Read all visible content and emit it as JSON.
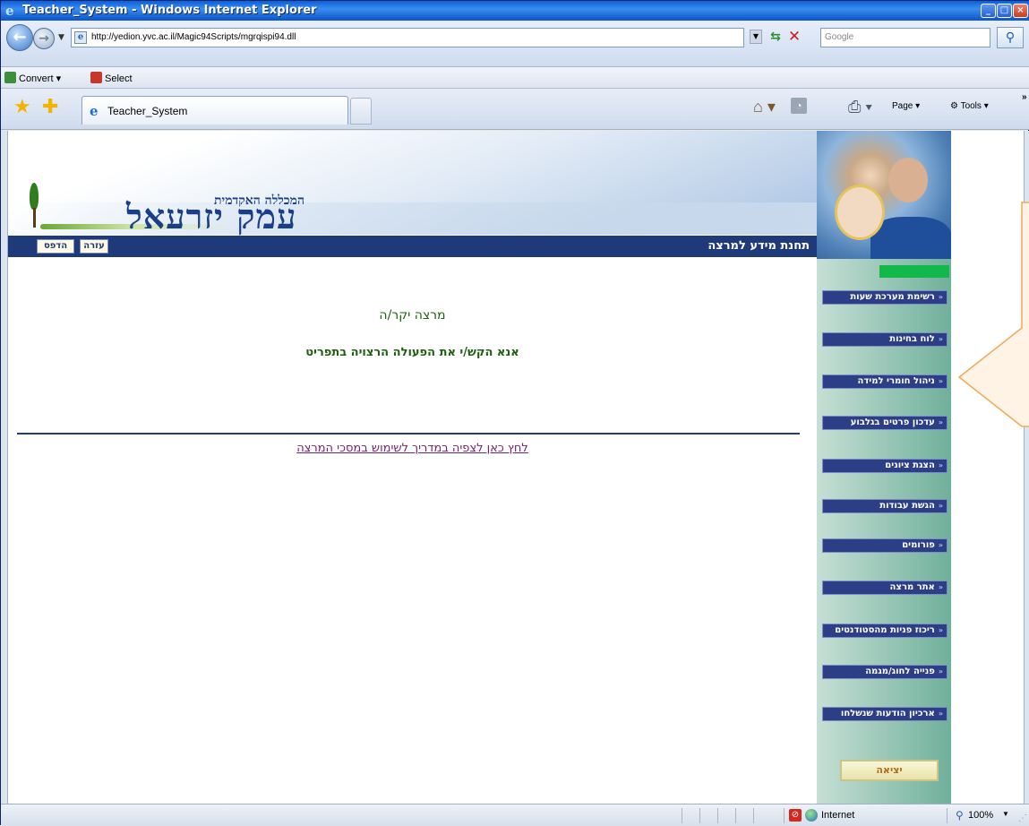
{
  "window": {
    "title": "Teacher_System - Windows Internet Explorer"
  },
  "address_bar": {
    "url": "http://yedion.yvc.ac.il/Magic94Scripts/mgrqispi94.dll",
    "search_placeholder": "Google"
  },
  "links_bar": {
    "convert_label": "Convert",
    "select_label": "Select"
  },
  "tab": {
    "label": "Teacher_System"
  },
  "command_bar": {
    "page_label": "Page",
    "tools_label": "Tools"
  },
  "header": {
    "logo_subtitle": "המכללה האקדמית",
    "logo_main": "עמק יזרעאל",
    "station_title": "תחנת מידע למרצה",
    "print_label": "הדפס",
    "help_label": "עזרה"
  },
  "main": {
    "greeting": "מרצה יקר/ה",
    "instruction": "אנא הקש/י את הפעולה הרצויה בתפריט",
    "guide_link": "לחץ כאן לצפיה במדריך לשימוש במסכי המרצה"
  },
  "sidebar": {
    "items": [
      "רשימת מערכת שעות",
      "לוח בחינות",
      "ניהול חומרי למידה",
      "עדכון פרטים בגלבוע",
      "הצגת ציונים",
      "הגשת עבודות",
      "פורומים",
      "אתר מרצה",
      "ריכוז פניות מהסטודנטים",
      "פנייה לחוג/מגמה",
      "ארכיון הודעות שנשלחו"
    ],
    "exit_label": "יציאה"
  },
  "status_bar": {
    "zone": "Internet",
    "zoom": "100%"
  },
  "colors": {
    "header_bar": "#1f3a7a",
    "menu_button": "#2c3f86",
    "greeting_text": "#1f5f12",
    "link_text": "#7a1e6e",
    "green_marker": "#13b84a"
  }
}
